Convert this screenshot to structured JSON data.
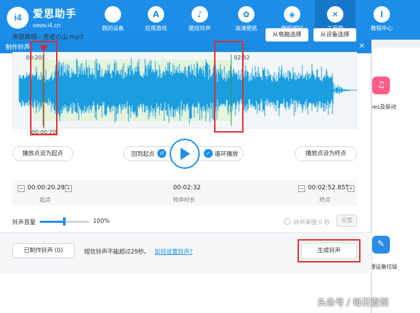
{
  "app": {
    "brand": "爱思助手",
    "url": "www.i4.cn",
    "logo_text": "i4"
  },
  "nav": {
    "items": [
      {
        "label": "我的设备",
        "icon": "apple-icon",
        "glyph": ""
      },
      {
        "label": "应用游戏",
        "icon": "app-store-icon",
        "glyph": "A"
      },
      {
        "label": "酷炫铃声",
        "icon": "bell-icon",
        "glyph": "♪"
      },
      {
        "label": "高清壁纸",
        "icon": "flower-icon",
        "glyph": "✿"
      },
      {
        "label": "刷机越狱",
        "icon": "box-icon",
        "glyph": "◈"
      },
      {
        "label": "工具箱",
        "icon": "tools-icon",
        "glyph": "✕"
      },
      {
        "label": "教程中心",
        "icon": "info-icon",
        "glyph": "i"
      }
    ],
    "active_index": 5
  },
  "side_panel": {
    "item1_label": "nes及驱动",
    "item2_label": "理设备垃圾"
  },
  "dialog": {
    "title": "制作铃声",
    "close_glyph": "×",
    "file_name": "岸部眞明 - 奇迹の山.mp3",
    "from_pc_label": "从电脑选择",
    "from_device_label": "从设备选择",
    "wave_start_time": "00:20",
    "wave_end_time": "02:52",
    "wave_current_time": "00:00:20",
    "set_start_label": "播放点设为起点",
    "set_end_label": "播放点设为终点",
    "back_to_start_label": "回到起点",
    "loop_label": "循环播放",
    "start_value": "00:00:20.288",
    "start_label": "起点",
    "duration_value": "00:02:32",
    "duration_label": "铃声时长",
    "end_value": "00:02:52.855",
    "end_label": "终点",
    "stepper_minus": "−",
    "stepper_plus": "+",
    "volume_label": "铃声音量",
    "volume_pct": "100%",
    "volume_fraction": 0.5,
    "fade_label": "铃声渐强 0 秒",
    "fade_set_label": "设置",
    "made_label": "已制作铃声 (0)",
    "sms_note": "短信铃声不能超过29秒。",
    "howto_link": "如何设置铃声?",
    "generate_label": "生成铃声",
    "watermark": "头条号 / 每日壹调"
  },
  "colors": {
    "accent": "#1c8ee8",
    "wave": "#1b9ee0",
    "highlight": "#e02a2a",
    "selection": "#e4f4dc"
  }
}
